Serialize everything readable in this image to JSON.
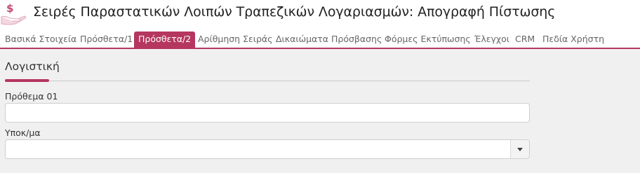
{
  "header": {
    "icon": "money-hand-icon",
    "title": "Σειρές Παραστατικών Λοιπών Τραπεζικών Λογαριασμών: Απογραφή Πίστωσης"
  },
  "tabs": [
    {
      "label": "Βασικά Στοιχεία",
      "active": false
    },
    {
      "label": "Πρόσθετα/1",
      "active": false
    },
    {
      "label": "Πρόσθετα/2",
      "active": true
    },
    {
      "label": "Αρίθμηση Σειράς",
      "active": false
    },
    {
      "label": "Δικαιώματα Πρόσβασης",
      "active": false
    },
    {
      "label": "Φόρμες Εκτύπωσης",
      "active": false
    },
    {
      "label": "Έλεγχοι",
      "active": false
    },
    {
      "label": "CRM",
      "active": false
    },
    {
      "label": "Πεδία Χρήστη",
      "active": false
    }
  ],
  "section": {
    "title": "Λογιστική"
  },
  "fields": {
    "prothema": {
      "label": "Πρόθεμα 01",
      "value": ""
    },
    "ypokma": {
      "label": "Υποκ/μα",
      "value": ""
    }
  },
  "colors": {
    "accent": "#b5365f",
    "icon": "#c24a70"
  }
}
